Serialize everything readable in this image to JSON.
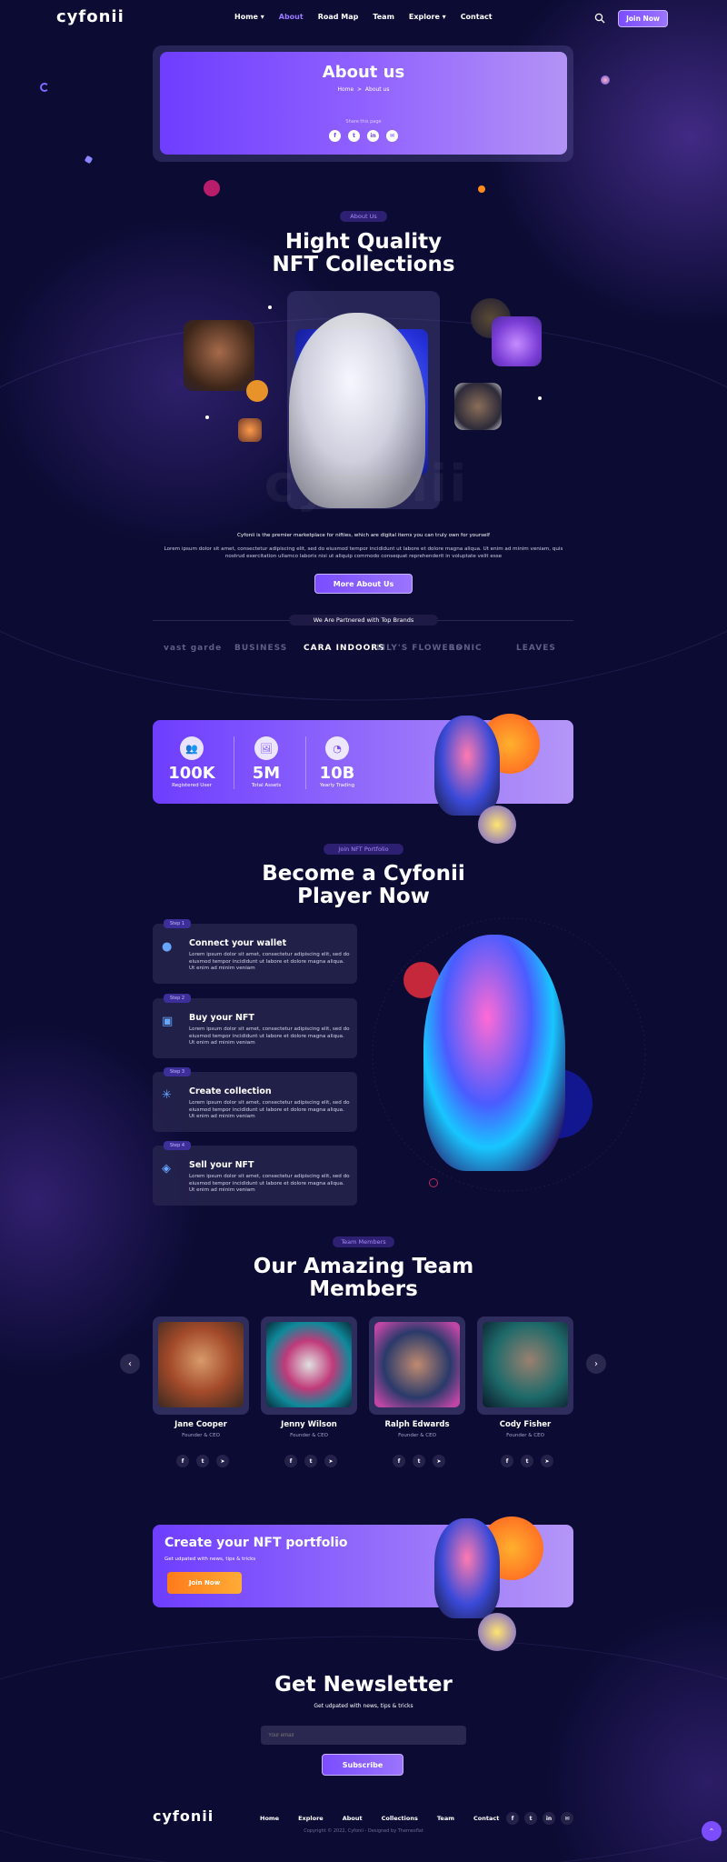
{
  "header": {
    "logo": "cyfonii",
    "nav": [
      "Home ▾",
      "About",
      "Road Map",
      "Team",
      "Explore ▾",
      "Contact"
    ],
    "active_nav": "About",
    "join_label": "Join Now"
  },
  "hero": {
    "title": "About us",
    "crumb_home": "Home",
    "crumb_sep": ">",
    "crumb_current": "About us",
    "share_label": "Share this page",
    "social": [
      "f",
      "t",
      "in",
      "✉"
    ]
  },
  "about": {
    "pill": "About Us",
    "title_line1": "Hight Quality",
    "title_line2": "NFT Collections",
    "watermark": "cyfonii",
    "text1": "Cyfonii is the premier marketplace for nifties, which are digital items you can truly own for yourself",
    "text2": "Lorem ipsum dolor sit amet, consectetur adipiscing elit, sed do eiusmod tempor incididunt ut labore et dolore magna aliqua. Ut enim ad minim veniam, quis nostrud exercitation ullamco laboris nisi ut aliquip commodo consequat reprehenderit in voluptate velit esse",
    "button": "More About Us"
  },
  "partners": {
    "label": "We Are Partnered with Top Brands",
    "brands": [
      "vast garde",
      "BUSINESS",
      "CARA INDOORS",
      "LILY'S FLOWERS",
      "SONIC",
      "LEAVES"
    ]
  },
  "stats": [
    {
      "icon": "users-icon",
      "glyph": "👥",
      "value": "100K",
      "label": "Registered User"
    },
    {
      "icon": "image-icon",
      "glyph": "🖼",
      "value": "5M",
      "label": "Total Assets"
    },
    {
      "icon": "pie-chart-icon",
      "glyph": "◔",
      "value": "10B",
      "label": "Yearly Trading"
    }
  ],
  "portfolio": {
    "pill": "Join NFT Portfolio",
    "title_line1": "Become a Cyfonii",
    "title_line2": "Player Now",
    "steps": [
      {
        "tag": "Step 1",
        "title": "Connect your wallet",
        "desc": "Lorem ipsum dolor sit amet, consectetur adipiscing elit, sed do eiusmod tempor incididunt ut labore et dolore magna aliqua. Ut enim ad minim veniam"
      },
      {
        "tag": "Step 2",
        "title": "Buy your NFT",
        "desc": "Lorem ipsum dolor sit amet, consectetur adipiscing elit, sed do eiusmod tempor incididunt ut labore et dolore magna aliqua. Ut enim ad minim veniam"
      },
      {
        "tag": "Step 3",
        "title": "Create collection",
        "desc": "Lorem ipsum dolor sit amet, consectetur adipiscing elit, sed do eiusmod tempor incididunt ut labore et dolore magna aliqua. Ut enim ad minim veniam"
      },
      {
        "tag": "Step 4",
        "title": "Sell your NFT",
        "desc": "Lorem ipsum dolor sit amet, consectetur adipiscing elit, sed do eiusmod tempor incididunt ut labore et dolore magna aliqua. Ut enim ad minim veniam"
      }
    ]
  },
  "team": {
    "pill": "Team Members",
    "title_line1": "Our Amazing Team",
    "title_line2": "Members",
    "prev": "‹",
    "next": "›",
    "members": [
      {
        "name": "Jane Cooper",
        "role": "Founder & CEO"
      },
      {
        "name": "Jenny Wilson",
        "role": "Founder & CEO"
      },
      {
        "name": "Ralph Edwards",
        "role": "Founder & CEO"
      },
      {
        "name": "Cody Fisher",
        "role": "Founder & CEO"
      }
    ],
    "social": [
      "f",
      "t",
      "➤"
    ]
  },
  "cta": {
    "title": "Create your NFT portfolio",
    "subtitle": "Get udpated with news, tips & tricks",
    "button": "Join Now"
  },
  "newsletter": {
    "title": "Get Newsletter",
    "subtitle": "Get udpated with news, tips & tricks",
    "placeholder": "Your email",
    "button": "Subscribe"
  },
  "footer": {
    "logo": "cyfonii",
    "nav": [
      "Home",
      "Explore",
      "About",
      "Collections",
      "Team",
      "Contact"
    ],
    "social": [
      "f",
      "t",
      "in",
      "✉"
    ],
    "copyright": "Copyright © 2022, Cyfonii - Designed by Themesflat",
    "top_arrow": "⌃"
  },
  "colors": {
    "accent": "#7b4dff",
    "orange": "#ff8a1f",
    "background": "#0b0b33"
  }
}
